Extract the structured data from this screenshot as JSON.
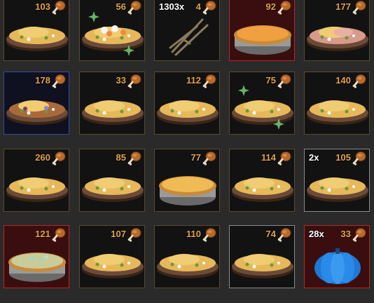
{
  "inventory": {
    "slots": [
      {
        "count": "103",
        "qty": "",
        "item": "pie-dish",
        "variant": "stuffing",
        "frame": "gold"
      },
      {
        "count": "56",
        "qty": "",
        "item": "pie-dish",
        "variant": "marshmallow-sparkle",
        "frame": "gold"
      },
      {
        "count": "4",
        "qty": "1303x",
        "item": "twigs",
        "variant": "twigs",
        "frame": "gold"
      },
      {
        "count": "92",
        "qty": "",
        "item": "pie-dish",
        "variant": "pumpkin-pie",
        "frame": "red"
      },
      {
        "count": "177",
        "qty": "",
        "item": "pie-dish",
        "variant": "ham",
        "frame": "gold"
      },
      {
        "count": "178",
        "qty": "",
        "item": "pie-dish",
        "variant": "berry",
        "frame": "blue"
      },
      {
        "count": "33",
        "qty": "",
        "item": "pie-dish",
        "variant": "stuffing",
        "frame": "gold"
      },
      {
        "count": "112",
        "qty": "",
        "item": "pie-dish",
        "variant": "stuffing",
        "frame": "gold"
      },
      {
        "count": "75",
        "qty": "",
        "item": "pie-dish",
        "variant": "stuffing-sparkle",
        "frame": "gold"
      },
      {
        "count": "140",
        "qty": "",
        "item": "pie-dish",
        "variant": "stuffing",
        "frame": "gold"
      },
      {
        "count": "260",
        "qty": "",
        "item": "pie-dish",
        "variant": "stuffing",
        "frame": "gold"
      },
      {
        "count": "85",
        "qty": "",
        "item": "pie-dish",
        "variant": "stuffing",
        "frame": "gold"
      },
      {
        "count": "77",
        "qty": "",
        "item": "pie-dish",
        "variant": "plain-pie",
        "frame": "gold"
      },
      {
        "count": "114",
        "qty": "",
        "item": "pie-dish",
        "variant": "stuffing",
        "frame": "gold"
      },
      {
        "count": "105",
        "qty": "2x",
        "item": "pie-dish",
        "variant": "stuffing",
        "frame": "white"
      },
      {
        "count": "121",
        "qty": "",
        "item": "pie-dish",
        "variant": "green-pie",
        "frame": "red"
      },
      {
        "count": "107",
        "qty": "",
        "item": "pie-dish",
        "variant": "stuffing",
        "frame": "gold"
      },
      {
        "count": "110",
        "qty": "",
        "item": "pie-dish",
        "variant": "stuffing",
        "frame": "gold"
      },
      {
        "count": "74",
        "qty": "",
        "item": "pie-dish",
        "variant": "stuffing",
        "frame": "white"
      },
      {
        "count": "33",
        "qty": "28x",
        "item": "blue-pumpkin",
        "variant": "blue-pumpkin",
        "frame": "red"
      }
    ]
  },
  "colors": {
    "count_text": "#e2a24a",
    "qty_text": "#ffffff",
    "frame_gold": "#5a4a2e",
    "frame_red": "#b02a2a",
    "frame_blue": "#3a4a9a"
  },
  "icons": {
    "stat_icon": "drumstick-icon"
  }
}
